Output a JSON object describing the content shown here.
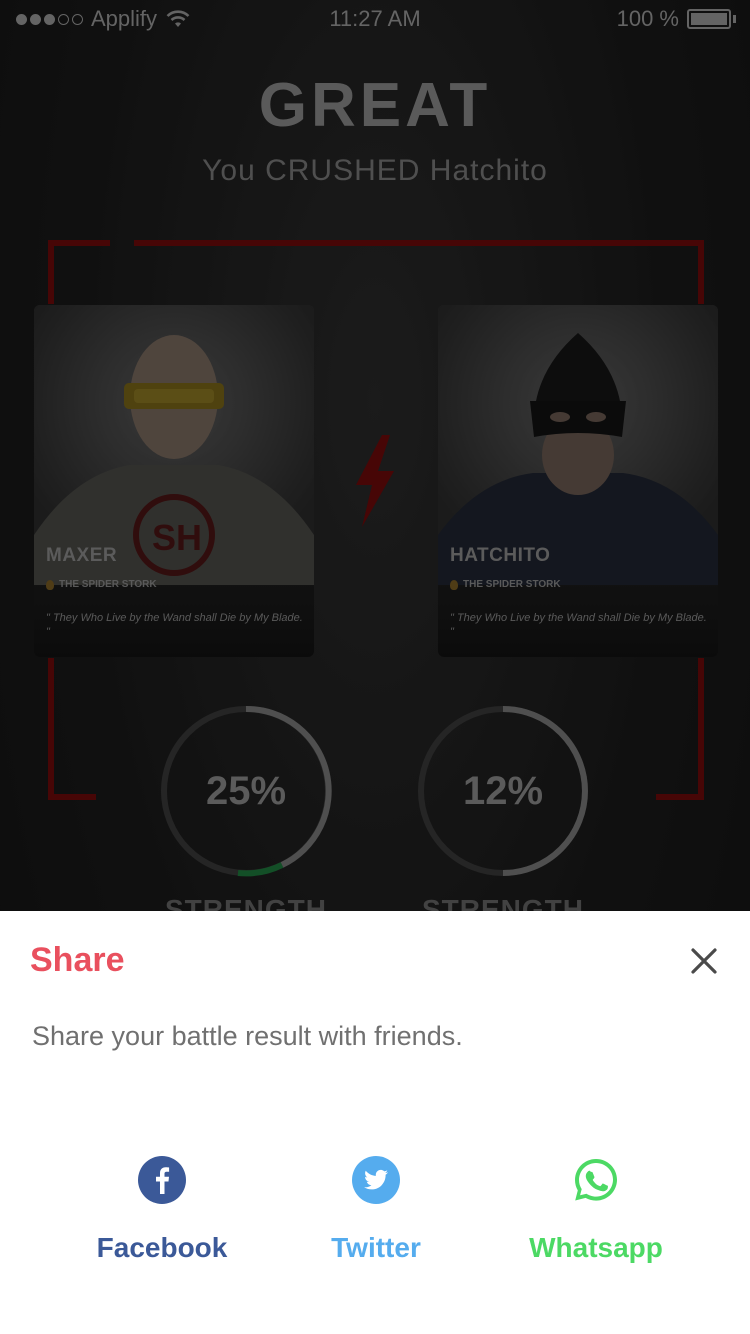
{
  "status_bar": {
    "carrier": "Applify",
    "time": "11:27 AM",
    "battery": "100 %"
  },
  "header": {
    "title": "GREAT",
    "subtitle": "You CRUSHED Hatchito"
  },
  "fighters": [
    {
      "name": "MAXER",
      "role": "THE SPIDER STORK",
      "quote": "\" They Who Live by the Wand shall Die by My Blade. \"",
      "strength_percent": "25%",
      "strength_value": 0.25,
      "strength_label": "STRENGTH"
    },
    {
      "name": "HATCHITO",
      "role": "THE SPIDER STORK",
      "quote": "\" They Who Live by the Wand shall Die by My Blade. \"",
      "strength_percent": "12%",
      "strength_value": 0.12,
      "strength_label": "STRENGTH"
    }
  ],
  "share_sheet": {
    "title": "Share",
    "description": "Share your battle result with friends.",
    "options": [
      {
        "label": "Facebook",
        "icon": "facebook-icon",
        "color": "#3b5998"
      },
      {
        "label": "Twitter",
        "icon": "twitter-icon",
        "color": "#55acee"
      },
      {
        "label": "Whatsapp",
        "icon": "whatsapp-icon",
        "color": "#4cd964"
      }
    ]
  },
  "colors": {
    "accent": "#e9505e",
    "frame_red": "#6e0a0a",
    "gauge_green": "#1e7a3c"
  }
}
